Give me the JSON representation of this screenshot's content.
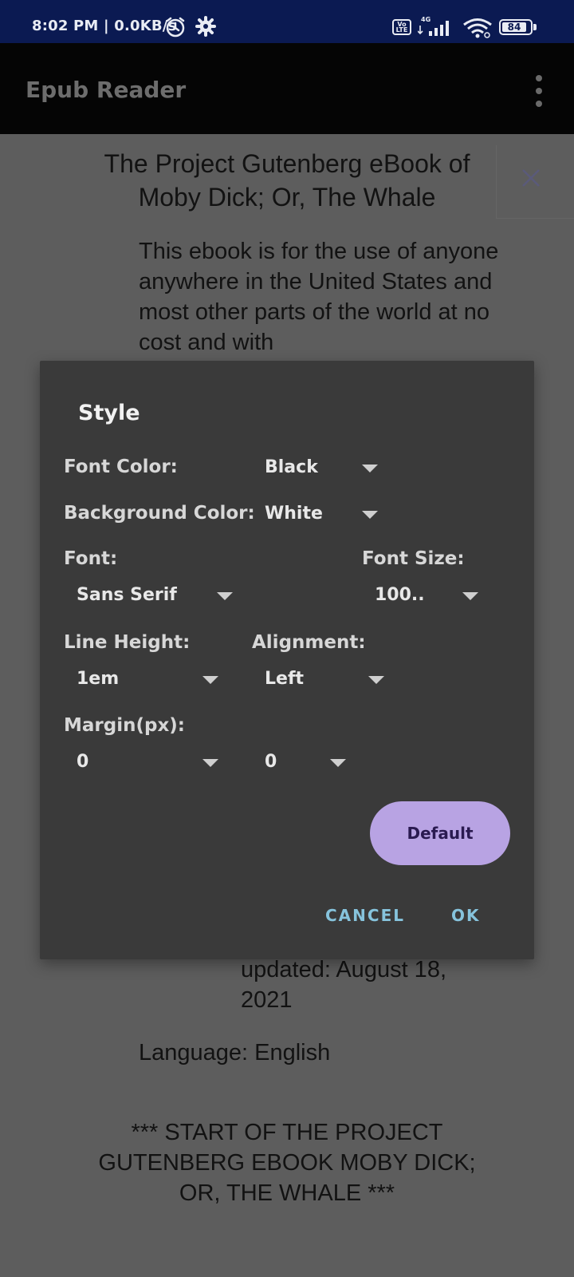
{
  "status_bar": {
    "time": "8:02 PM | 0.0KB/s",
    "volte": "Vo LTE",
    "network": "4G",
    "battery": "84"
  },
  "app_bar": {
    "title": "Epub Reader",
    "menu_icon": "more-vert-icon"
  },
  "book": {
    "heading": "The Project Gutenberg eBook of Moby Dick; Or, The Whale",
    "paragraph": "This ebook is for the use of anyone anywhere in the United States and most other parts of the world at no cost and with",
    "updated": "updated: August 18, 2021",
    "language": "Language: English",
    "start_marker": "*** START OF THE PROJECT GUTENBERG EBOOK MOBY DICK; OR, THE WHALE ***",
    "close_icon": "close-icon"
  },
  "dialog": {
    "title": "Style",
    "font_color_label": "Font Color:",
    "font_color_value": "Black",
    "background_color_label": "Background Color:",
    "background_color_value": "White",
    "font_label": "Font:",
    "font_value": "Sans Serif",
    "font_size_label": "Font Size:",
    "font_size_value": "100..",
    "line_height_label": "Line Height:",
    "line_height_value": "1em",
    "alignment_label": "Alignment:",
    "alignment_value": "Left",
    "margin_label": "Margin(px):",
    "margin_value_1": "0",
    "margin_value_2": "0",
    "default_button": "Default",
    "cancel_button": "CANCEL",
    "ok_button": "OK"
  },
  "colors": {
    "status_bar_bg": "#0b1a52",
    "dialog_bg": "#3a3a3a",
    "default_button_bg": "#b8a3e3",
    "action_text": "#86c3dc"
  }
}
